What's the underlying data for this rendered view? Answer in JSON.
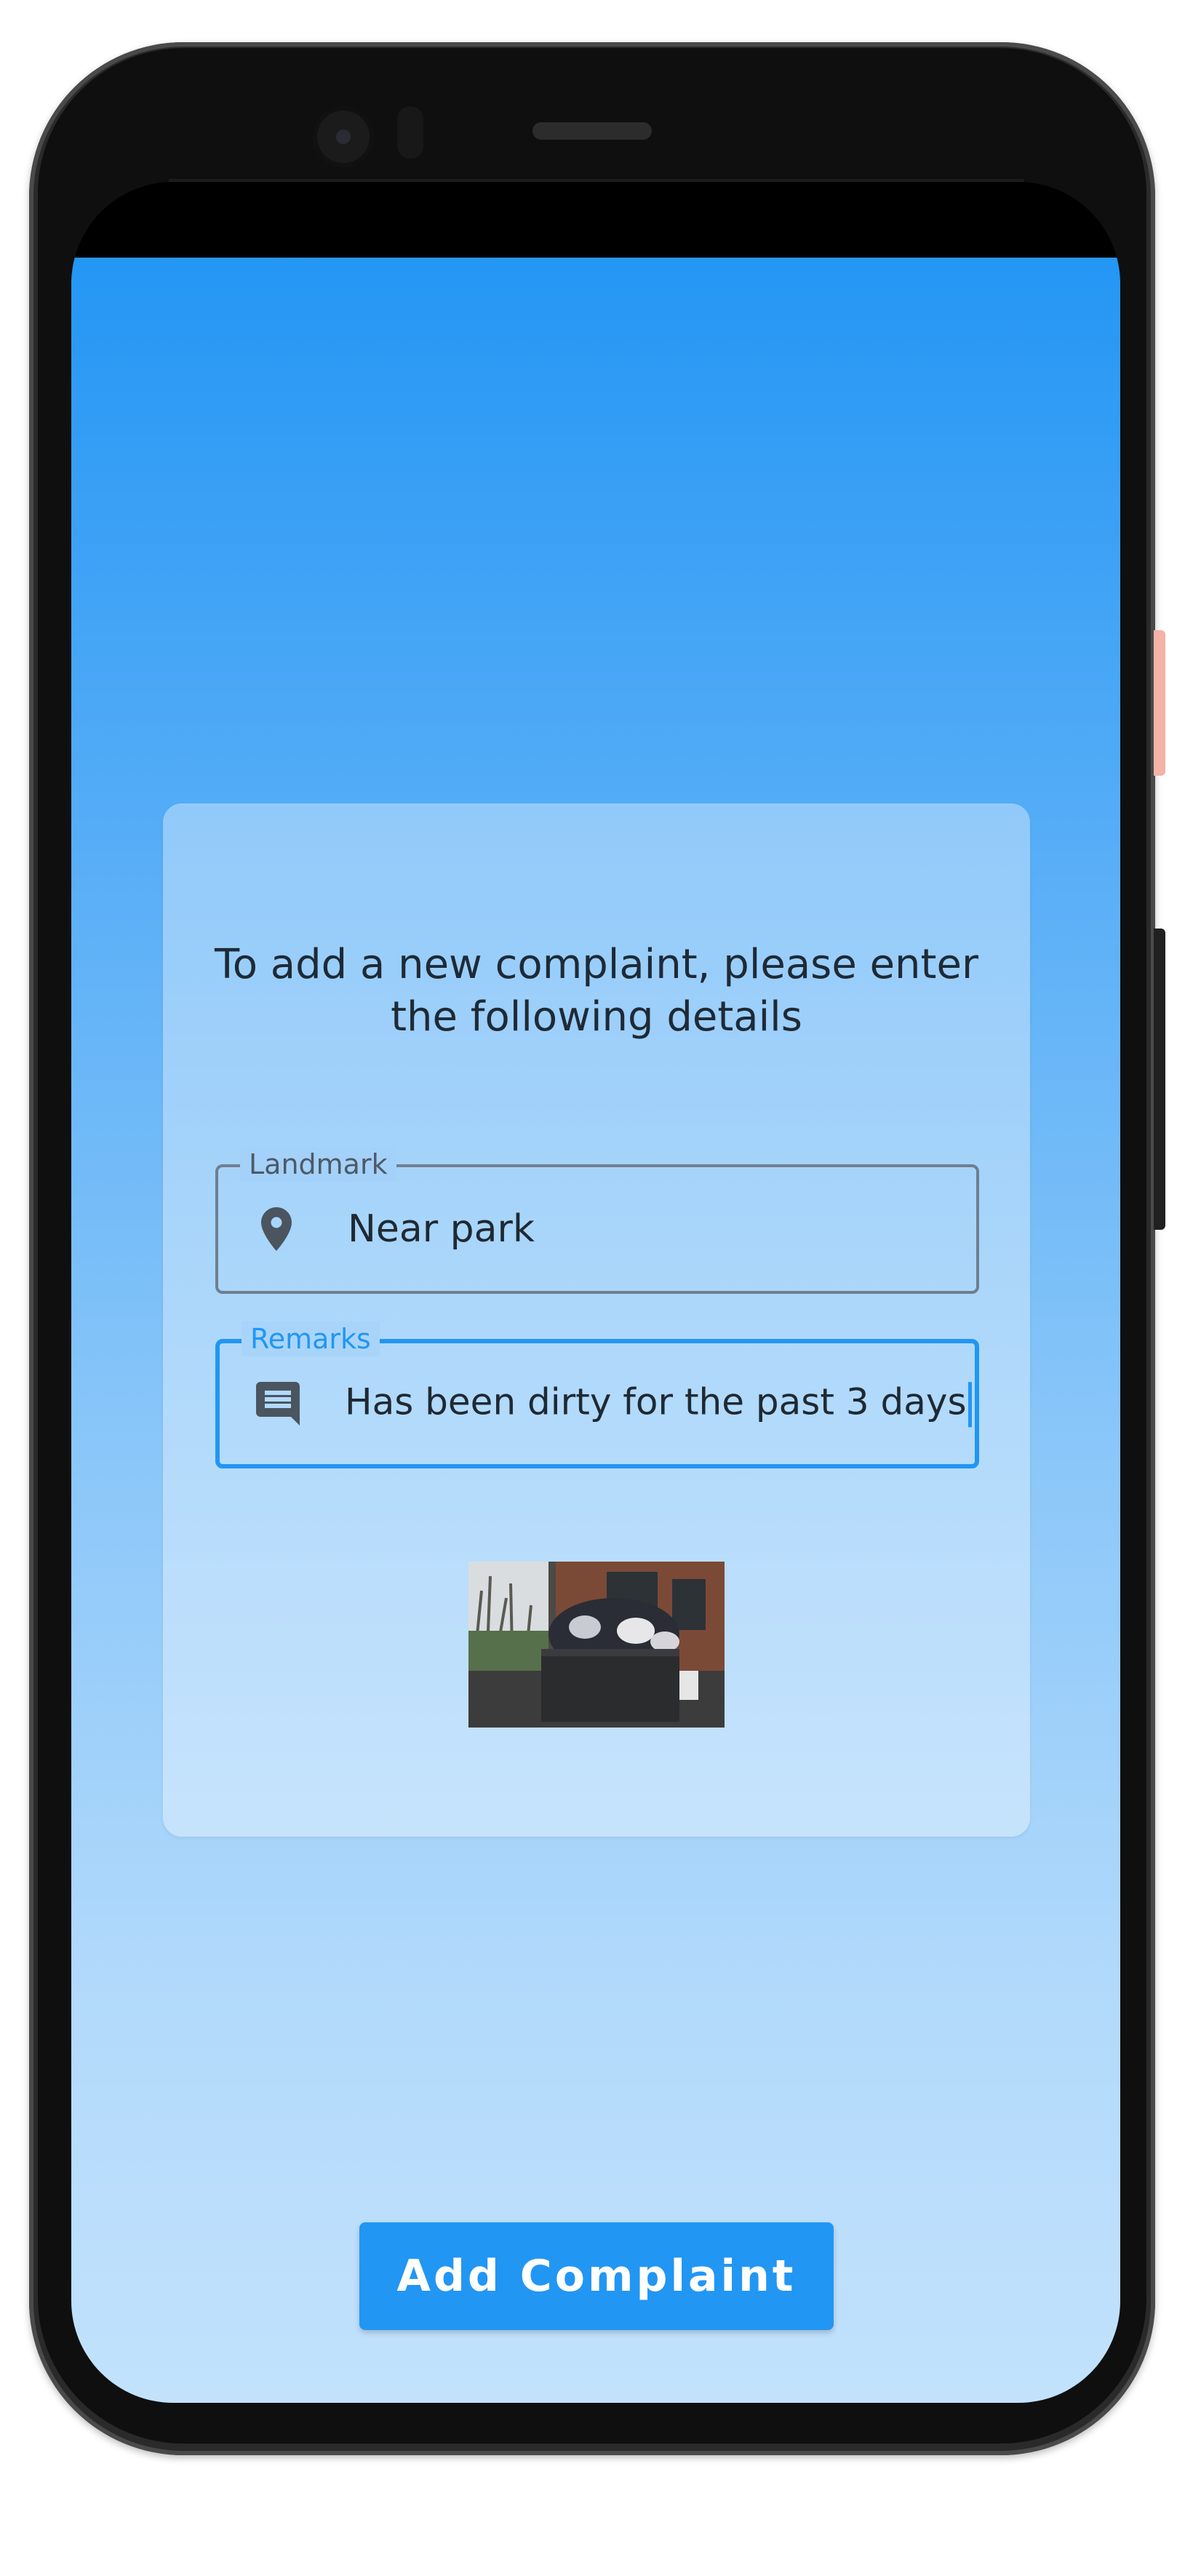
{
  "form": {
    "heading": "To add a new complaint, please enter the following details",
    "landmark": {
      "label": "Landmark",
      "value": "Near park",
      "icon": "location-pin-icon"
    },
    "remarks": {
      "label": "Remarks",
      "value": "Has been dirty for the past 3 days",
      "icon": "comment-icon"
    }
  },
  "actions": {
    "add_label": "Add Complaint"
  },
  "colors": {
    "accent": "#2196f3",
    "gradient_top": "#2496f4",
    "gradient_bottom": "#c2e2fc"
  }
}
